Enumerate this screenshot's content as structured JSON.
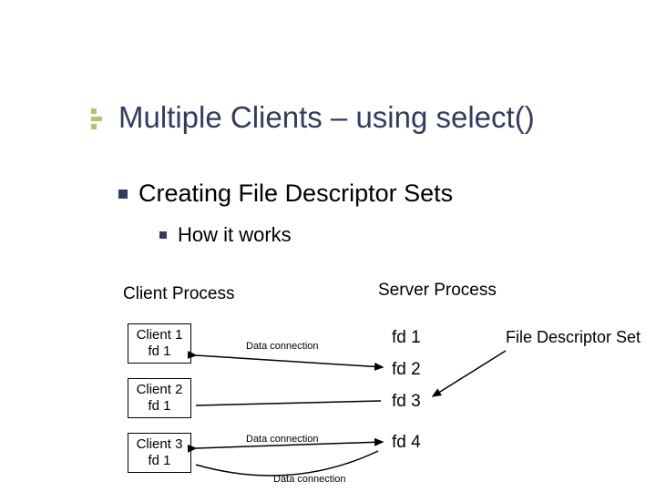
{
  "title": "Multiple Clients – using select()",
  "bullets": {
    "level1": "Creating File Descriptor Sets",
    "level2": "How it works"
  },
  "labels": {
    "client_process": "Client Process",
    "server_process": "Server Process",
    "fd_set": "File Descriptor Set",
    "data_connection": "Data connection"
  },
  "clients": [
    {
      "name": "Client 1",
      "fd": "fd 1"
    },
    {
      "name": "Client 2",
      "fd": "fd 1"
    },
    {
      "name": "Client 3",
      "fd": "fd 1"
    }
  ],
  "server_fds": [
    "fd 1",
    "fd 2",
    "fd 3",
    "fd 4"
  ]
}
